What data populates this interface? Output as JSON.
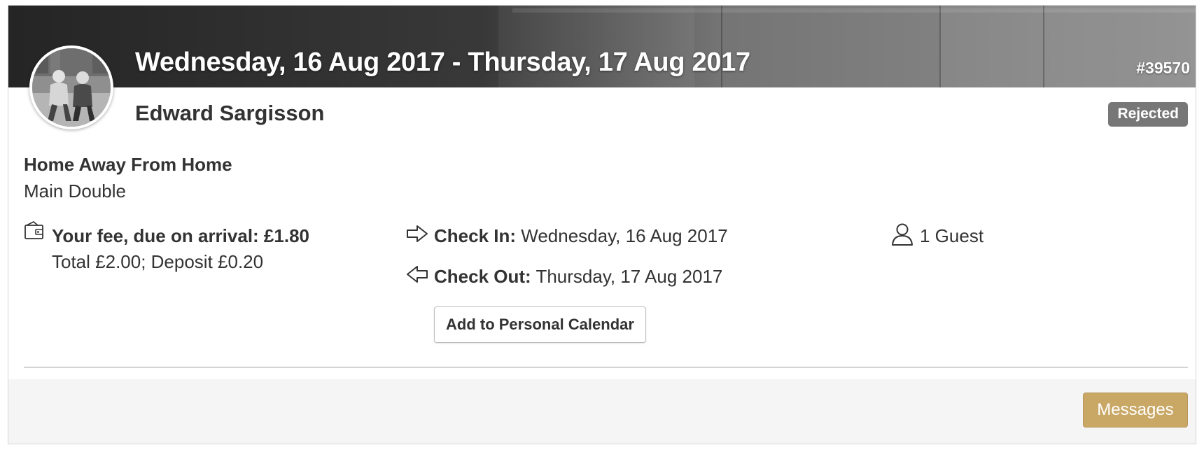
{
  "booking": {
    "dates": "Wednesday, 16 Aug 2017 - Thursday, 17 Aug 2017",
    "reference": "#39570",
    "guest_name": "Edward Sargisson",
    "status": "Rejected",
    "property": "Home Away From Home",
    "room": "Main Double"
  },
  "fee": {
    "label": "Your fee, due on arrival: £1.80",
    "detail": "Total £2.00; Deposit £0.20",
    "icon": "wallet-icon"
  },
  "check_in": {
    "label": "Check In:",
    "value": "Wednesday, 16 Aug 2017",
    "icon": "arrow-right-icon"
  },
  "check_out": {
    "label": "Check Out:",
    "value": "Thursday, 17 Aug 2017",
    "icon": "arrow-left-icon"
  },
  "guests": {
    "value": "1 Guest",
    "icon": "user-icon"
  },
  "actions": {
    "add_calendar": "Add to Personal Calendar",
    "messages": "Messages"
  },
  "colors": {
    "accent": "#c9a765",
    "badge": "#777777"
  }
}
